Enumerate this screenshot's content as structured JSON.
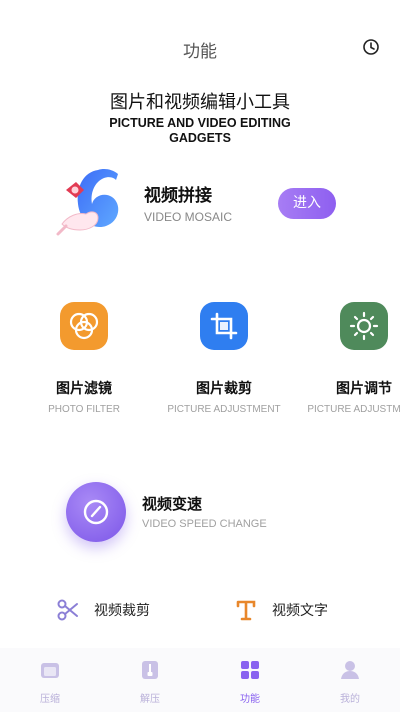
{
  "header": {
    "title": "功能"
  },
  "hero": {
    "title": "图片和视频编辑小工具",
    "subtitle": "PICTURE AND VIDEO EDITING GADGETS"
  },
  "mosaic": {
    "title": "视频拼接",
    "subtitle": "VIDEO MOSAIC",
    "button": "进入"
  },
  "tools": [
    {
      "title": "图片滤镜",
      "subtitle": "PHOTO FILTER",
      "icon": "photo-filter-icon",
      "color": "#f39a2e"
    },
    {
      "title": "图片裁剪",
      "subtitle": "PICTURE ADJUSTMENT",
      "icon": "crop-icon",
      "color": "#2f7ef0"
    },
    {
      "title": "图片调节",
      "subtitle": "PICTURE ADJUSTMENT",
      "icon": "brightness-icon",
      "color": "#4f8a5b"
    }
  ],
  "speed": {
    "title": "视频变速",
    "subtitle": "VIDEO SPEED CHANGE"
  },
  "small_tools": [
    {
      "label": "视频裁剪",
      "icon": "scissors-icon"
    },
    {
      "label": "视频文字",
      "icon": "text-icon"
    }
  ],
  "tabbar": {
    "active": "功能",
    "items": [
      {
        "label": "压缩",
        "icon": "compress-icon"
      },
      {
        "label": "解压",
        "icon": "decompress-icon"
      },
      {
        "label": "功能",
        "icon": "function-grid-icon"
      },
      {
        "label": "我的",
        "icon": "profile-icon"
      }
    ]
  },
  "colors": {
    "accent": "#8a63f0",
    "tab_inactive": "#b9b0d9",
    "subtext": "#a0a0a0"
  }
}
